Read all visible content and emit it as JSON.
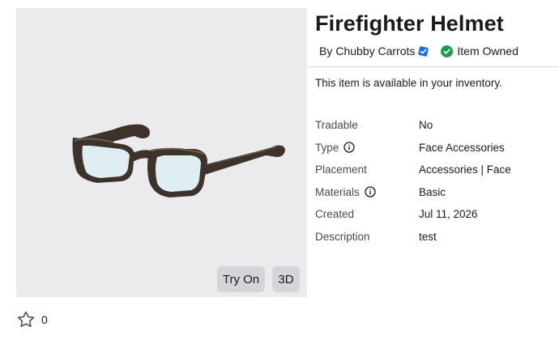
{
  "item": {
    "title": "Firefighter Helmet",
    "by_label": "By",
    "creator": "Chubby Carrots",
    "owned_label": "Item Owned",
    "inventory_notice": "This item is available in your inventory."
  },
  "thumbnail": {
    "try_on_label": "Try On",
    "view_3d_label": "3D"
  },
  "details": [
    {
      "label": "Tradable",
      "value": "No",
      "info": false
    },
    {
      "label": "Type",
      "value": "Face Accessories",
      "info": true
    },
    {
      "label": "Placement",
      "value": "Accessories | Face",
      "info": false
    },
    {
      "label": "Materials",
      "value": "Basic",
      "info": true
    },
    {
      "label": "Created",
      "value": "Jul 11, 2026",
      "info": false
    },
    {
      "label": "Description",
      "value": "test",
      "info": false
    }
  ],
  "favorite": {
    "count": "0"
  },
  "colors": {
    "verified_badge": "#1f6bf0",
    "owned_check": "#1a9e4b",
    "thumb_bg": "#ebebed",
    "button_bg": "#d4d5d8"
  },
  "icons": {
    "verified": "verified-badge-icon",
    "owned": "check-circle-icon",
    "info": "info-icon",
    "favorite": "star-outline-icon"
  }
}
